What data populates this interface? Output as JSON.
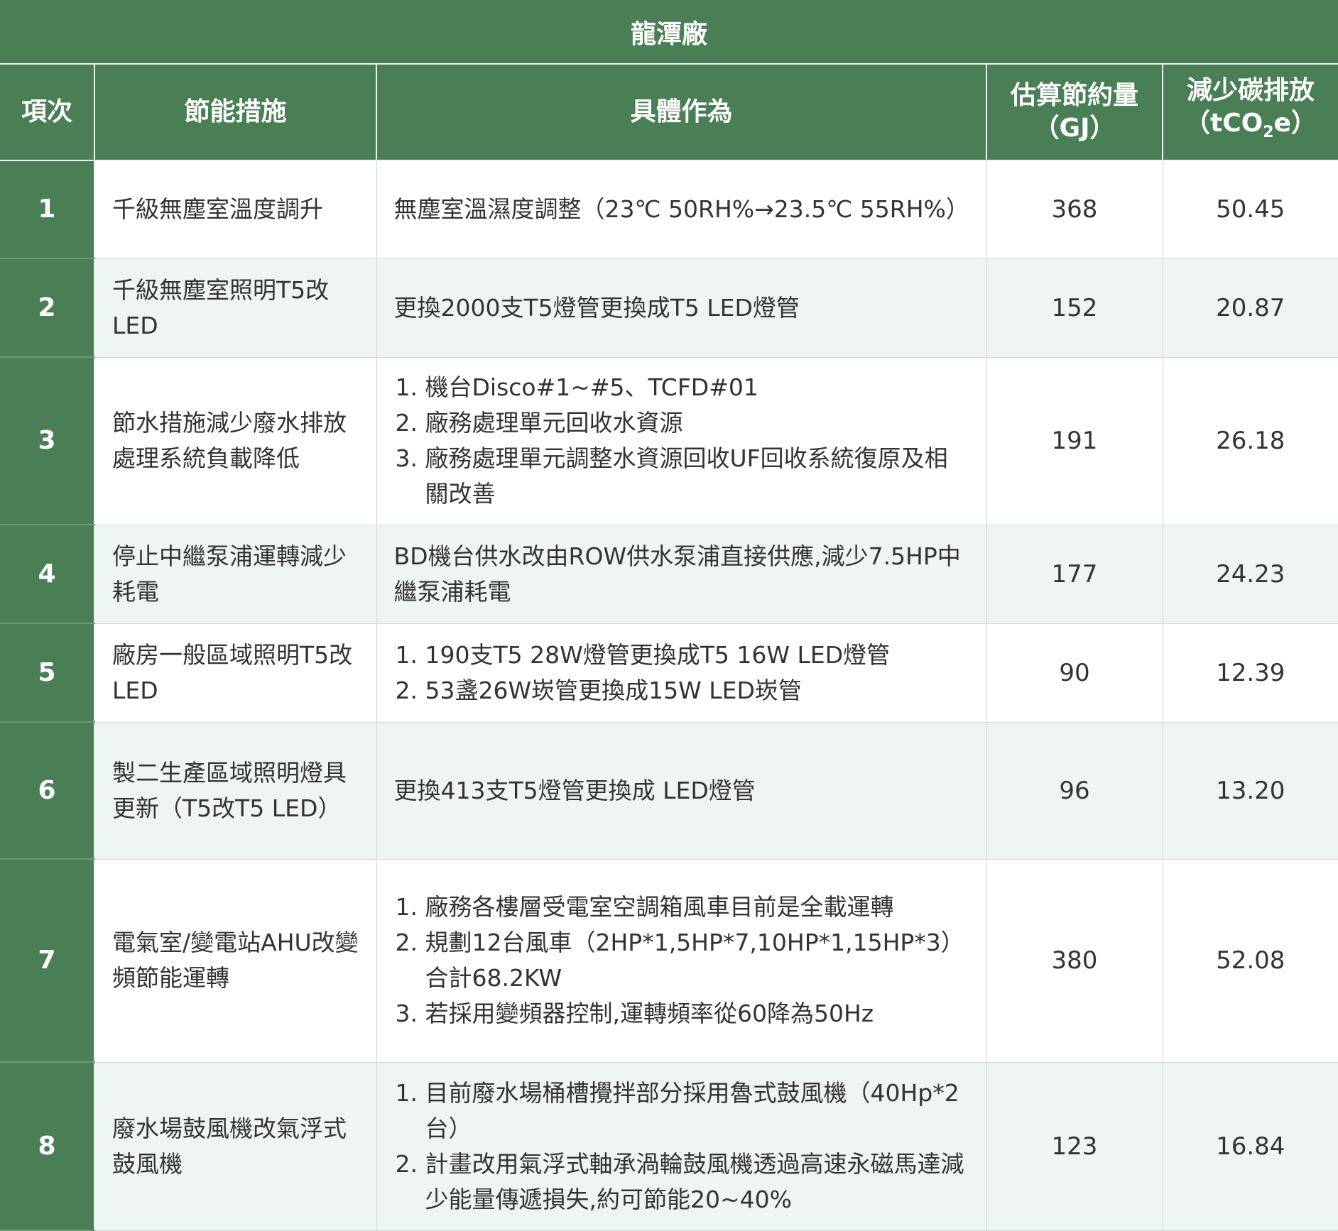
{
  "table": {
    "title": "龍潭廠",
    "headers": {
      "item": "項次",
      "measure": "節能措施",
      "action": "具體作為",
      "saving_line1": "估算節約量",
      "saving_line2": "（GJ）",
      "carbon_line1": "減少碳排放",
      "carbon_pre": "（tCO",
      "carbon_sub": "2",
      "carbon_post": "e）"
    },
    "rows": [
      {
        "no": "1",
        "measure": "千級無塵室溫度調升",
        "action_text": "無塵室溫濕度調整（23℃ 50RH%→23.5℃ 55RH%）",
        "actions": [],
        "gj": "368",
        "co2": "50.45"
      },
      {
        "no": "2",
        "measure": "千級無塵室照明T5改LED",
        "action_text": "更換2000支T5燈管更換成T5 LED燈管",
        "actions": [],
        "gj": "152",
        "co2": "20.87"
      },
      {
        "no": "3",
        "measure": "節水措施減少廢水排放處理系統負載降低",
        "action_text": "",
        "actions": [
          "機台Disco#1~#5、TCFD#01",
          "廠務處理單元回收水資源",
          "廠務處理單元調整水資源回收UF回收系統復原及相關改善"
        ],
        "gj": "191",
        "co2": "26.18"
      },
      {
        "no": "4",
        "measure": "停止中繼泵浦運轉減少耗電",
        "action_text": "BD機台供水改由ROW供水泵浦直接供應,減少7.5HP中繼泵浦耗電",
        "actions": [],
        "gj": "177",
        "co2": "24.23"
      },
      {
        "no": "5",
        "measure": "廠房一般區域照明T5改LED",
        "action_text": "",
        "actions": [
          "190支T5 28W燈管更換成T5 16W LED燈管",
          "53盞26W崁管更換成15W LED崁管"
        ],
        "gj": "90",
        "co2": "12.39"
      },
      {
        "no": "6",
        "measure": "製二生產區域照明燈具更新（T5改T5 LED）",
        "action_text": "更換413支T5燈管更換成 LED燈管",
        "actions": [],
        "gj": "96",
        "co2": "13.20"
      },
      {
        "no": "7",
        "measure": "電氣室/變電站AHU改變頻節能運轉",
        "action_text": "",
        "actions": [
          "廠務各樓層受電室空調箱風車目前是全載運轉",
          "規劃12台風車（2HP*1,5HP*7,10HP*1,15HP*3）合計68.2KW",
          "若採用變頻器控制,運轉頻率從60降為50Hz"
        ],
        "gj": "380",
        "co2": "52.08"
      },
      {
        "no": "8",
        "measure": "廢水場鼓風機改氣浮式鼓風機",
        "action_text": "",
        "actions": [
          "目前廢水場桶槽攪拌部分採用魯式鼓風機（40Hp*2台）",
          "計畫改用氣浮式軸承渦輪鼓風機透過高速永磁馬達減少能量傳遞損失,約可節能20~40%"
        ],
        "gj": "123",
        "co2": "16.84"
      }
    ]
  }
}
